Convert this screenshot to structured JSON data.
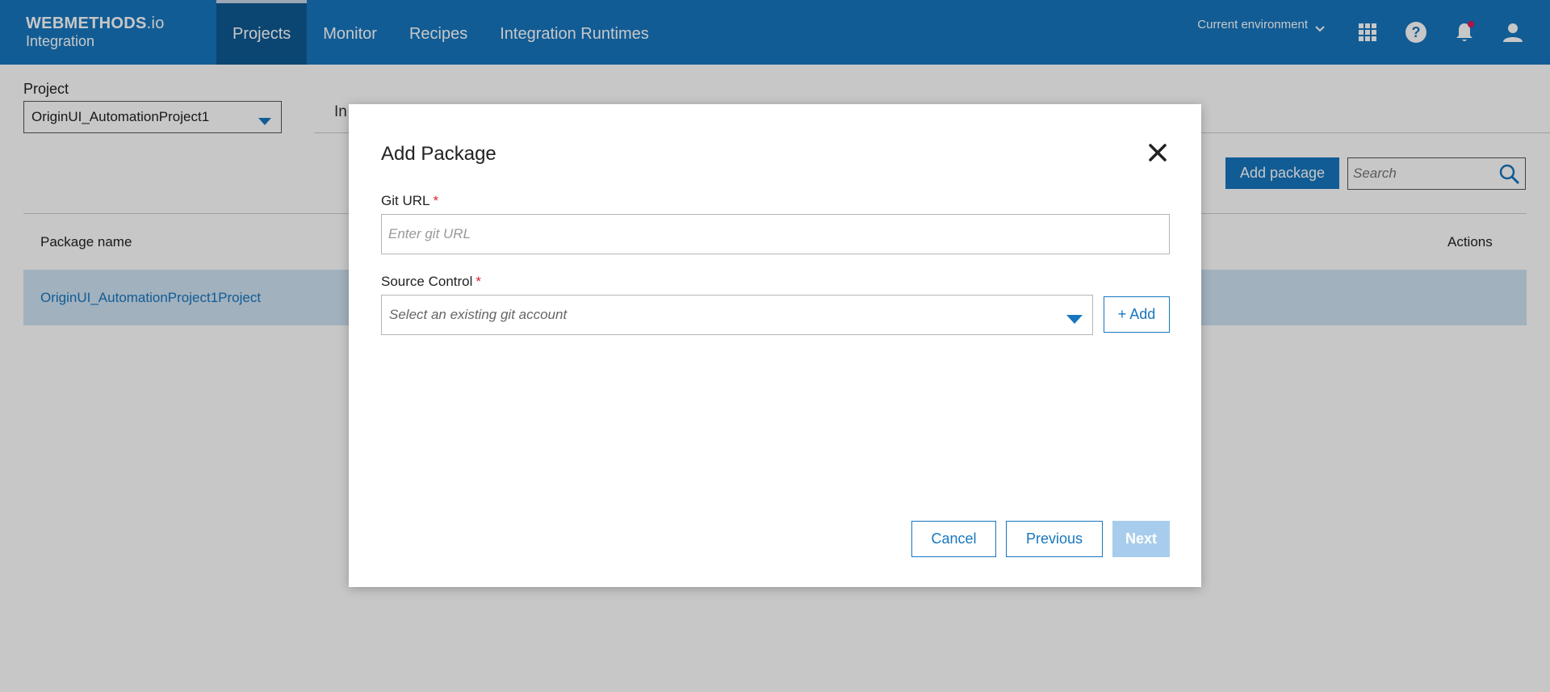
{
  "header": {
    "brand_name": "WEBMETHODS",
    "brand_suffix": ".io",
    "brand_product": "Integration",
    "nav": [
      "Projects",
      "Monitor",
      "Recipes",
      "Integration Runtimes"
    ],
    "active_nav": "Projects",
    "environment_label": "Current environment",
    "icons": [
      "apps-grid-icon",
      "help-icon",
      "notification-bell-icon",
      "user-icon"
    ],
    "notification_dot_color": "#e0195a"
  },
  "page": {
    "project_label": "Project",
    "project_value": "OriginUI_AutomationProject1",
    "tab_partial": "In",
    "add_package_label": "Add package",
    "search_placeholder": "Search",
    "table": {
      "columns": [
        "Package name",
        "Actions"
      ],
      "rows": [
        {
          "name": "OriginUI_AutomationProject1Project"
        }
      ]
    }
  },
  "modal": {
    "title": "Add Package",
    "git_url_label": "Git URL",
    "git_url_placeholder": "Enter git URL",
    "git_url_value": "",
    "required_mark": "*",
    "source_control_label": "Source Control",
    "source_control_placeholder": "Select an existing git account",
    "add_label": "+ Add",
    "cancel_label": "Cancel",
    "previous_label": "Previous",
    "next_label": "Next",
    "next_disabled": true
  },
  "colors": {
    "primary": "#1776bf",
    "header_active": "#0f5a94",
    "selected_row": "#cfe3f4",
    "required": "#d9232e",
    "disabled_button": "#a8cdec"
  }
}
